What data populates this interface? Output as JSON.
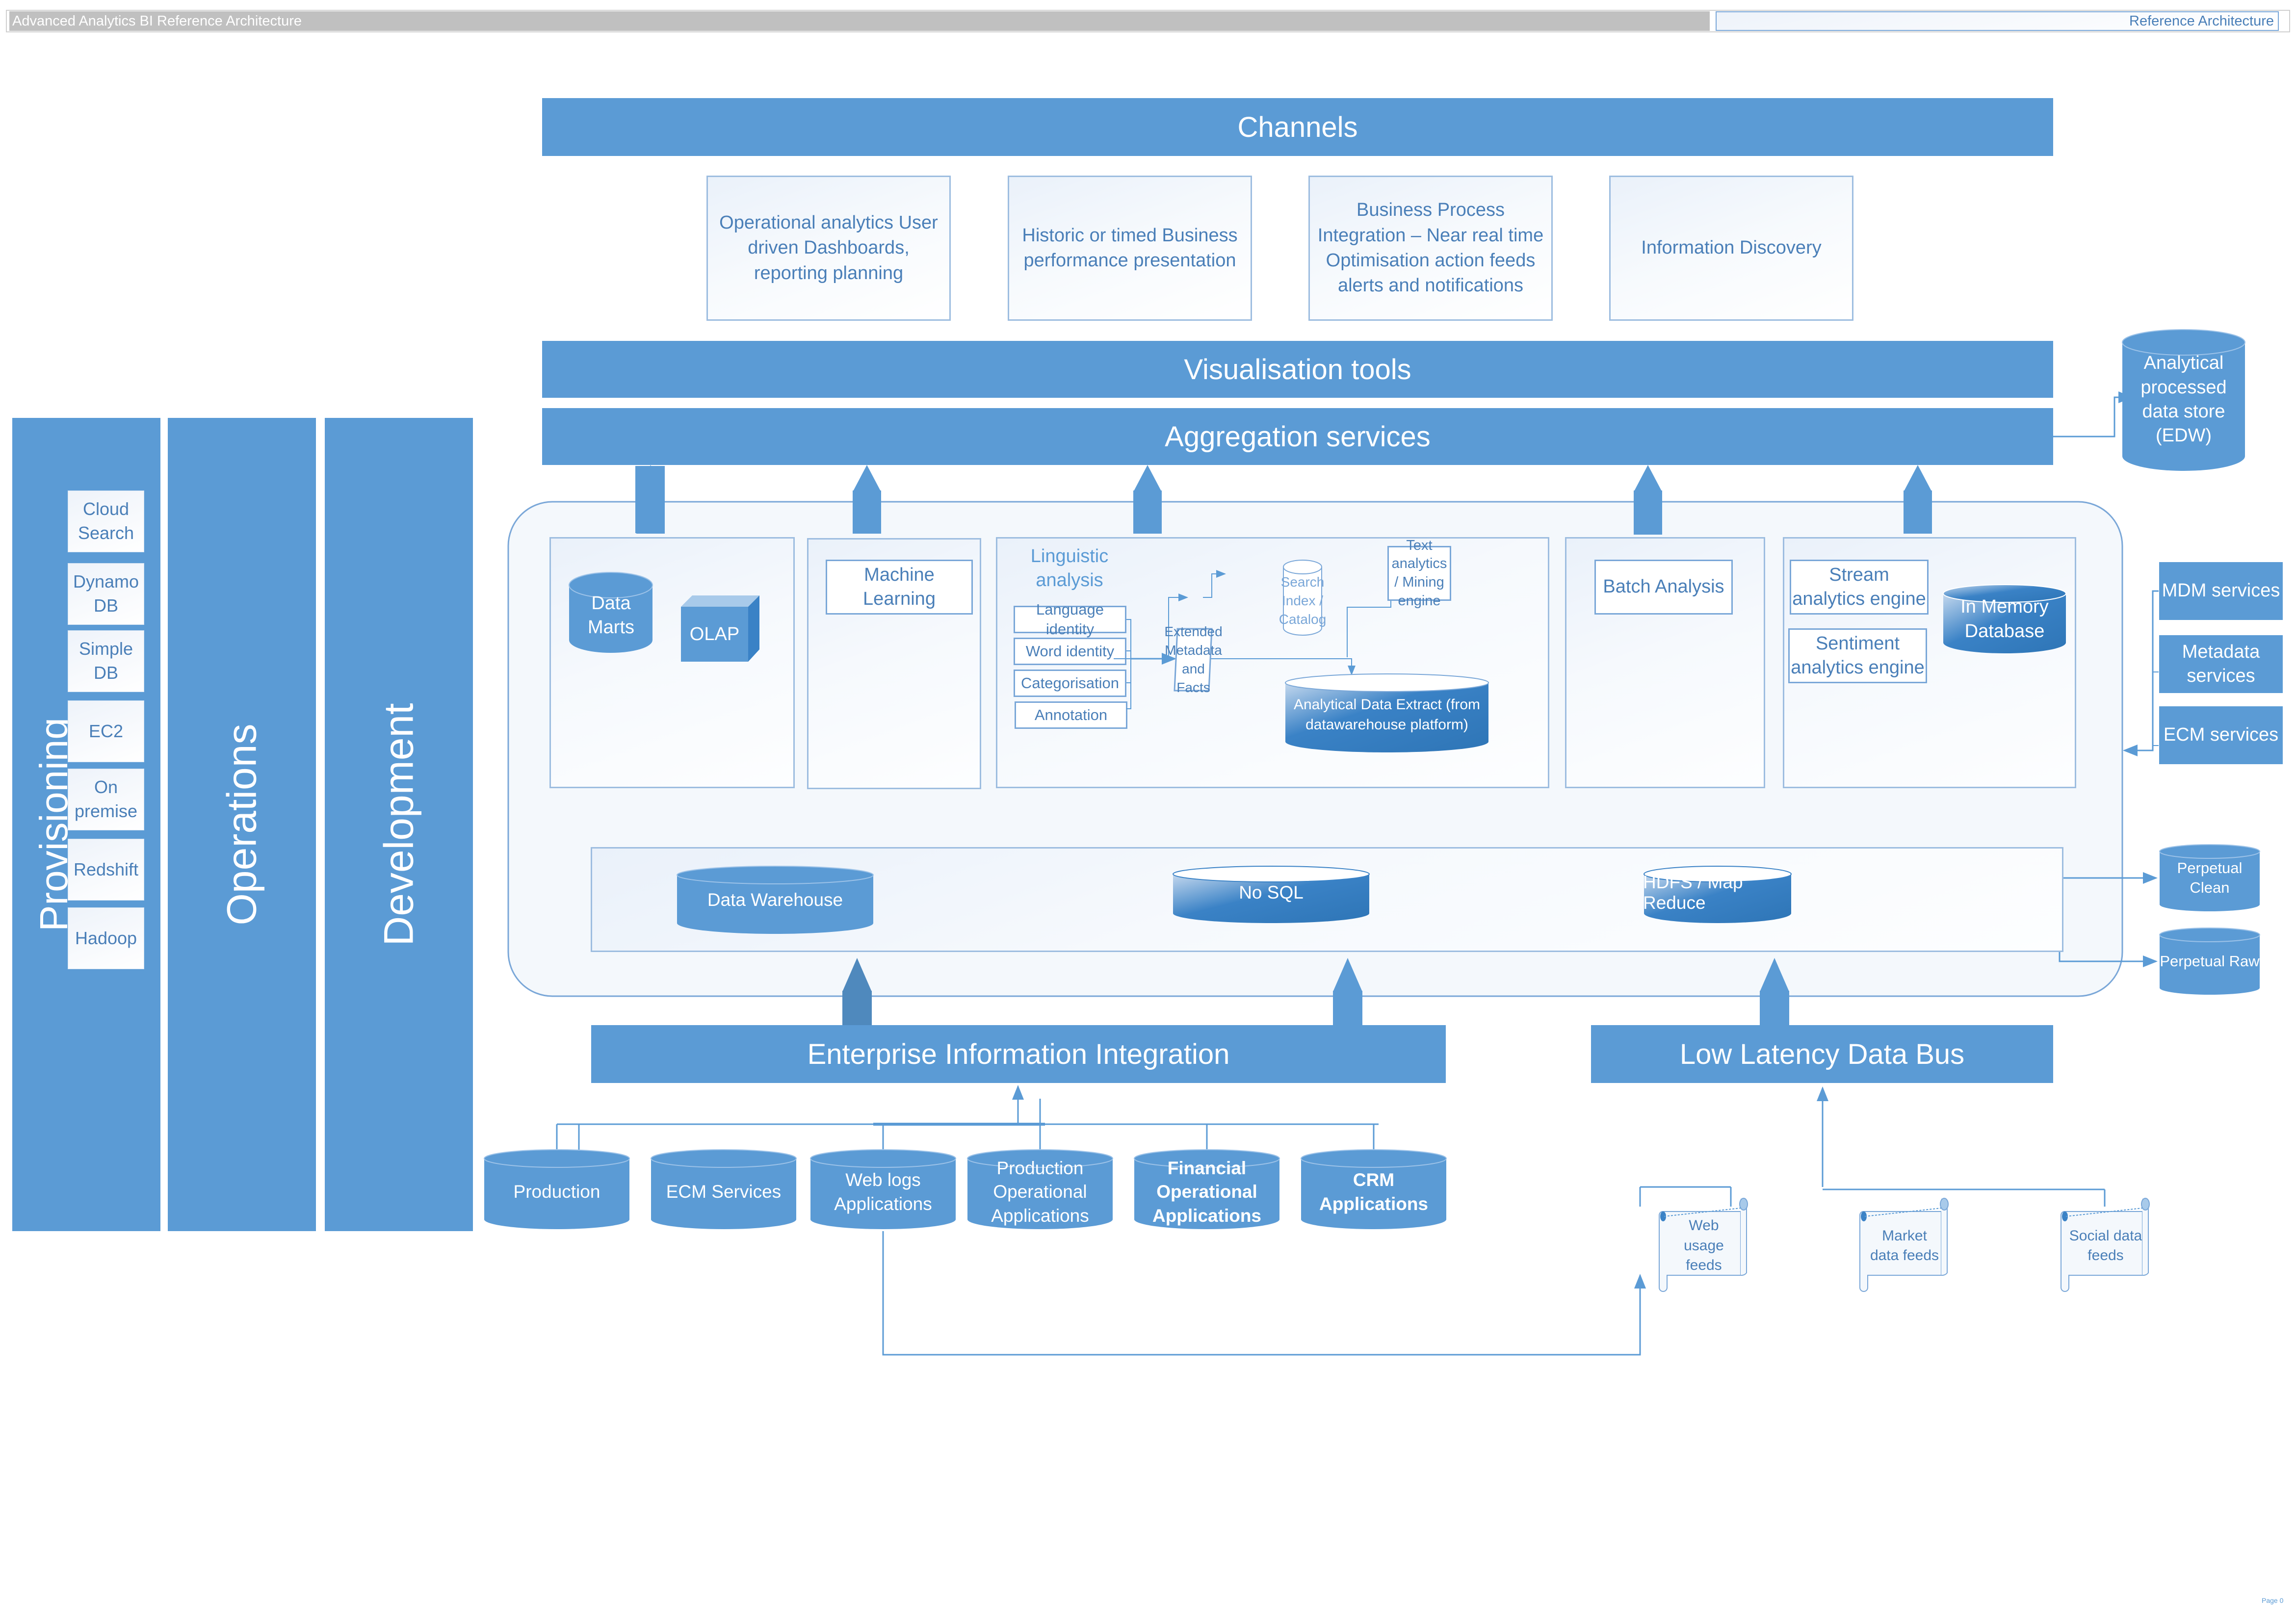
{
  "header": {
    "title": "Advanced Analytics BI Reference Architecture",
    "subtitle": "Reference Architecture"
  },
  "channels": {
    "title": "Channels",
    "items": [
      {
        "label": "Operational analytics User driven Dashboards, reporting planning"
      },
      {
        "label": "Historic or timed Business performance presentation"
      },
      {
        "label": "Business Process Integration – Near real time Optimisation action feeds alerts and notifications"
      },
      {
        "label": "Information Discovery"
      }
    ]
  },
  "layers": {
    "visualisation": "Visualisation tools",
    "aggregation": "Aggregation services",
    "eii": "Enterprise Information Integration",
    "low_latency": "Low Latency Data Bus"
  },
  "side_columns": {
    "provisioning": {
      "label": "Provisioning",
      "items": [
        "Cloud Search",
        "Dynamo DB",
        "Simple DB",
        "EC2",
        "On premise",
        "Redshift",
        "Hadoop"
      ]
    },
    "operations": {
      "label": "Operations"
    },
    "development": {
      "label": "Development"
    }
  },
  "analytics": {
    "data_marts": "Data Marts",
    "olap": "OLAP",
    "machine_learning": "Machine Learning",
    "linguistic": {
      "title": "Linguistic analysis",
      "steps": [
        "Language identity",
        "Word identity",
        "Categorisation",
        "Annotation"
      ],
      "extended": "Extended Metadata and Facts",
      "search_index": "Search Index / Catalog",
      "text_analytics": "Text analytics / Mining engine",
      "extract": "Analytical Data Extract (from datawarehouse platform)"
    },
    "batch": "Batch Analysis",
    "stream": "Stream analytics engine",
    "sentiment": "Sentiment analytics engine",
    "in_memory": "In Memory Database"
  },
  "storage": {
    "items": [
      "Data Warehouse",
      "No SQL",
      "HDFS / Map Reduce"
    ]
  },
  "right_side": {
    "edw": "Analytical processed data store (EDW)",
    "services": [
      "MDM services",
      "Metadata services",
      "ECM services"
    ],
    "perpetual": [
      "Perpetual Clean",
      "Perpetual Raw"
    ]
  },
  "sources": {
    "items": [
      {
        "label": "Production",
        "bold": false
      },
      {
        "label": "ECM Services",
        "bold": false
      },
      {
        "label": "Web logs Applications",
        "bold": false
      },
      {
        "label": "Production Operational Applications",
        "bold": false
      },
      {
        "label": "Financial Operational Applications",
        "bold": true
      },
      {
        "label": "CRM Applications",
        "bold": true
      }
    ]
  },
  "feeds": {
    "items": [
      "Web usage feeds",
      "Market data feeds",
      "Social data feeds"
    ]
  },
  "footer": {
    "page": "Page 0"
  },
  "colors": {
    "primary": "#5b9bd5",
    "text_blue": "#4a7fb8",
    "dark_blue": "#3a82c6",
    "border": "#9dbde0",
    "header_gray": "#c0c0c0"
  }
}
